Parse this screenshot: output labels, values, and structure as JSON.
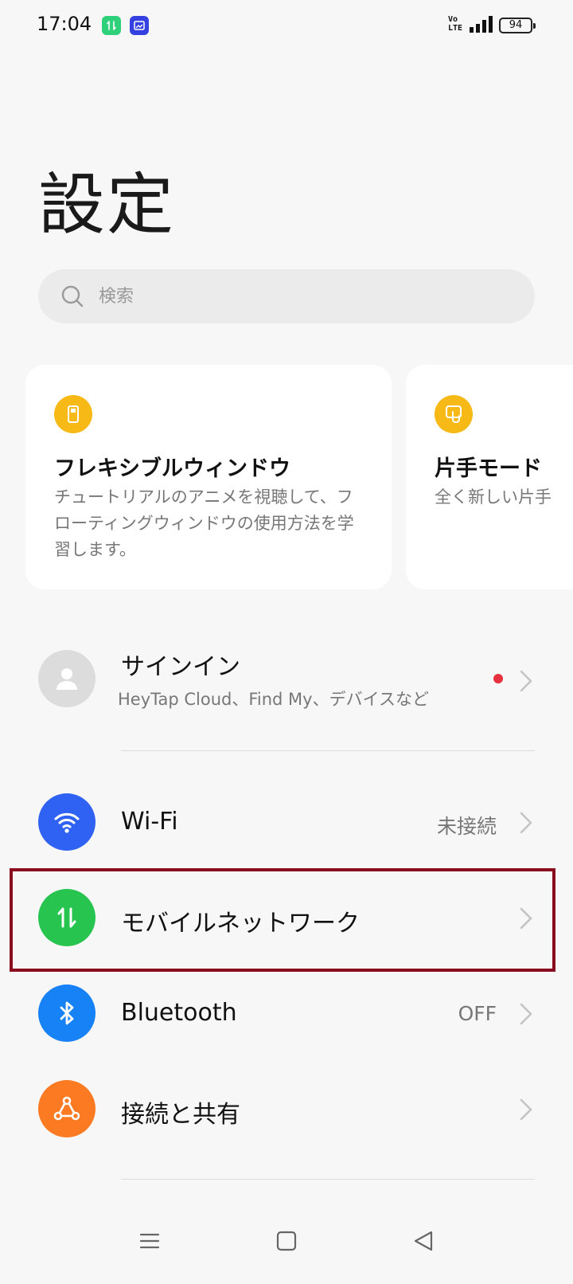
{
  "status_bar": {
    "time": "17:04",
    "app_icons": [
      "mobile-data-app-icon",
      "gallery-app-icon"
    ],
    "network": "VoLTE",
    "network_top": "Vo",
    "network_bottom": "LTE",
    "battery": "94"
  },
  "header": {
    "title": "設定"
  },
  "search": {
    "placeholder": "検索",
    "icon": "search-icon"
  },
  "cards": [
    {
      "icon": "flexible-window-icon",
      "title": "フレキシブルウィンドウ",
      "description": "チュートリアルのアニメを視聴して、フローティングウィンドウの使用方法を学習します。"
    },
    {
      "icon": "one-hand-mode-icon",
      "title": "片手モード",
      "description": "全く新しい片手"
    }
  ],
  "signin": {
    "title": "サインイン",
    "subtitle": "HeyTap Cloud、Find My、デバイスなど",
    "icon": "avatar-icon"
  },
  "settings_rows": [
    {
      "id": "wifi",
      "label": "Wi-Fi",
      "value": "未接続",
      "icon": "wifi-icon",
      "color": "#2f62f2"
    },
    {
      "id": "mobile",
      "label": "モバイルネットワーク",
      "value": "",
      "icon": "mobile-data-icon",
      "color": "#27c450"
    },
    {
      "id": "bluetooth",
      "label": "Bluetooth",
      "value": "OFF",
      "icon": "bluetooth-icon",
      "color": "#1782f5"
    },
    {
      "id": "share",
      "label": "接続と共有",
      "value": "",
      "icon": "connection-share-icon",
      "color": "#fb7a22"
    }
  ],
  "nav_bar": {
    "buttons": [
      "menu-icon",
      "home-icon",
      "back-icon"
    ]
  }
}
